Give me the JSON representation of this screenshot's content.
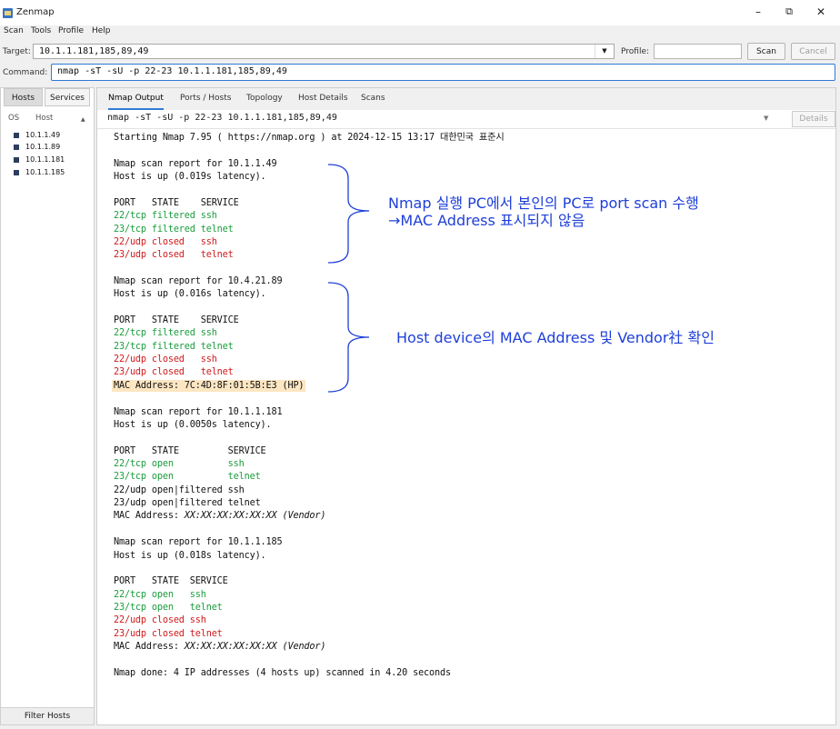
{
  "window": {
    "title": "Zenmap",
    "minimize": "–",
    "restore": "⧉",
    "close": "✕"
  },
  "menu": [
    "Scan",
    "Tools",
    "Profile",
    "Help"
  ],
  "toolbar": {
    "target_label": "Target:",
    "target_value": "10.1.1.181,185,89,49",
    "profile_label": "Profile:",
    "profile_value": "",
    "scan_label": "Scan",
    "cancel_label": "Cancel",
    "command_label": "Command:",
    "command_value": "nmap -sT -sU -p 22-23 10.1.1.181,185,89,49"
  },
  "left": {
    "tabs": [
      "Hosts",
      "Services"
    ],
    "col_os": "OS",
    "col_host": "Host",
    "hosts": [
      "10.1.1.49",
      "10.1.1.89",
      "10.1.1.181",
      "10.1.1.185"
    ],
    "filter_label": "Filter Hosts"
  },
  "right": {
    "tabs": [
      "Nmap Output",
      "Ports / Hosts",
      "Topology",
      "Host Details",
      "Scans"
    ],
    "output_cmd": "nmap -sT -sU -p 22-23 10.1.1.181,185,89,49",
    "details_label": "Details"
  },
  "output": [
    {
      "t": "Starting Nmap 7.95 ( https://nmap.org ) at 2024-12-15 13:17 대한민국 표준시"
    },
    {
      "t": ""
    },
    {
      "t": "Nmap scan report for 10.1.1.49"
    },
    {
      "t": "Host is up (0.019s latency)."
    },
    {
      "t": ""
    },
    {
      "t": "PORT   STATE    SERVICE"
    },
    {
      "t": "22/tcp filtered ssh",
      "c": "g"
    },
    {
      "t": "23/tcp filtered telnet",
      "c": "g"
    },
    {
      "t": "22/udp closed   ssh",
      "c": "r"
    },
    {
      "t": "23/udp closed   telnet",
      "c": "r"
    },
    {
      "t": ""
    },
    {
      "t": "Nmap scan report for 10.4.21.89"
    },
    {
      "t": "Host is up (0.016s latency)."
    },
    {
      "t": ""
    },
    {
      "t": "PORT   STATE    SERVICE"
    },
    {
      "t": "22/tcp filtered ssh",
      "c": "g"
    },
    {
      "t": "23/tcp filtered telnet",
      "c": "g"
    },
    {
      "t": "22/udp closed   ssh",
      "c": "r"
    },
    {
      "t": "23/udp closed   telnet",
      "c": "r"
    },
    {
      "t": "MAC Address: 7C:4D:8F:01:5B:E3 (HP)",
      "c": "hl"
    },
    {
      "t": ""
    },
    {
      "t": "Nmap scan report for 10.1.1.181"
    },
    {
      "t": "Host is up (0.0050s latency)."
    },
    {
      "t": ""
    },
    {
      "t": "PORT   STATE         SERVICE"
    },
    {
      "t": "22/tcp open          ssh",
      "c": "g"
    },
    {
      "t": "23/tcp open          telnet",
      "c": "g"
    },
    {
      "t": "22/udp open|filtered ssh"
    },
    {
      "t": "23/udp open|filtered telnet"
    },
    {
      "t": "MAC Address: ",
      "i": "XX:XX:XX:XX:XX:XX (Vendor)"
    },
    {
      "t": ""
    },
    {
      "t": "Nmap scan report for 10.1.1.185"
    },
    {
      "t": "Host is up (0.018s latency)."
    },
    {
      "t": ""
    },
    {
      "t": "PORT   STATE  SERVICE"
    },
    {
      "t": "22/tcp open   ssh",
      "c": "g"
    },
    {
      "t": "23/tcp open   telnet",
      "c": "g"
    },
    {
      "t": "22/udp closed ssh",
      "c": "r"
    },
    {
      "t": "23/udp closed telnet",
      "c": "r"
    },
    {
      "t": "MAC Address: ",
      "i": "XX:XX:XX:XX:XX:XX (Vendor)"
    },
    {
      "t": ""
    },
    {
      "t": "Nmap done: 4 IP addresses (4 hosts up) scanned in 4.20 seconds"
    }
  ],
  "annotations": {
    "a1_line1": "Nmap 실행 PC에서 본인의 PC로 port scan 수행",
    "a1_line2": "→MAC Address 표시되지 않음",
    "a2": "Host device의 MAC Address 및 Vendor社 확인",
    "color": "#1e3fd8"
  }
}
